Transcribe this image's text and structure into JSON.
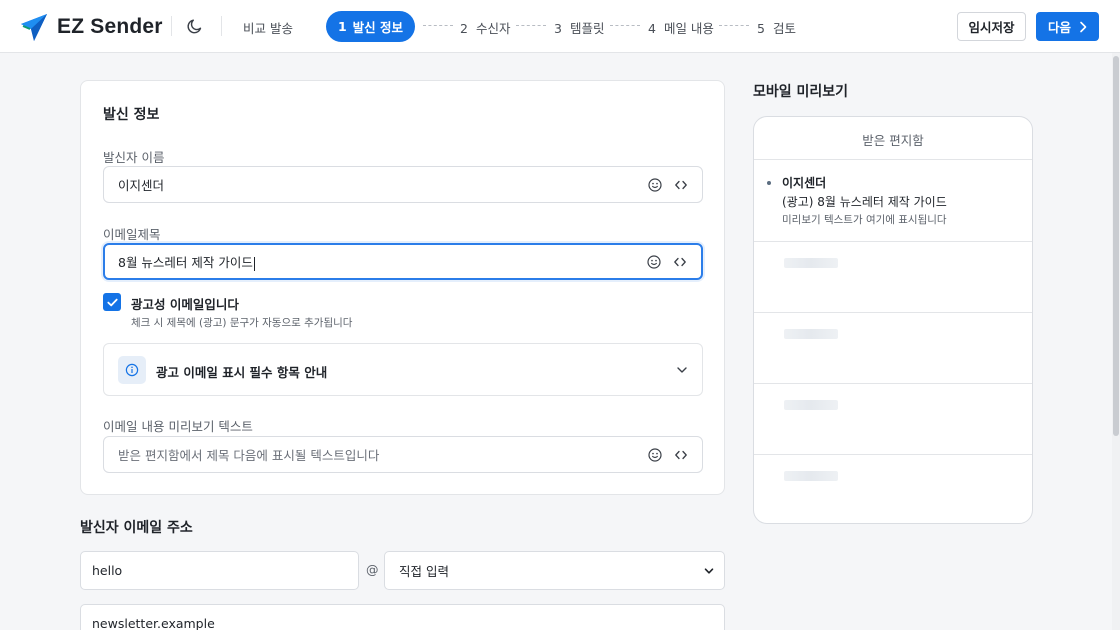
{
  "header": {
    "app_name": "EZ Sender",
    "compare_label": "비교 발송",
    "steps": [
      {
        "num": "1",
        "label": "발신 정보"
      },
      {
        "num": "2",
        "label": "수신자"
      },
      {
        "num": "3",
        "label": "템플릿"
      },
      {
        "num": "4",
        "label": "메일 내용"
      },
      {
        "num": "5",
        "label": "검토"
      }
    ],
    "active_step": 1,
    "save_label": "임시저장",
    "next_label": "다음",
    "accent_color": "#1473e6"
  },
  "sender_info": {
    "title": "발신 정보",
    "sender_name": {
      "label": "발신자 이름",
      "value": "이지센더"
    },
    "subject": {
      "label": "이메일제목",
      "value": "8월 뉴스레터 제작 가이드"
    },
    "ad_checkbox": {
      "checked": true,
      "label": "광고성 이메일입니다",
      "help": "체크 시 제목에 (광고) 문구가 자동으로 추가됩니다"
    },
    "ad_notice": {
      "label": "광고 이메일 표시 필수 항목 안내"
    },
    "preview_text": {
      "label": "이메일 내용 미리보기 텍스트",
      "placeholder": "받은 편지함에서 제목 다음에 표시될 텍스트입니다"
    }
  },
  "sender_email": {
    "title": "발신자 이메일 주소",
    "local_part": "hello",
    "at": "@",
    "domain_select": "직접 입력",
    "domain_value": "newsletter.example"
  },
  "mobile_preview": {
    "title": "모바일 미리보기",
    "inbox_label": "받은 편지함",
    "mail": {
      "sender": "이지센더",
      "subject": "(광고) 8월 뉴스레터 제작 가이드",
      "preview": "미리보기 텍스트가 여기에 표시됩니다"
    }
  },
  "icons": [
    "send-logo-icon",
    "moon-icon",
    "emoji-icon",
    "code-icon",
    "check-icon",
    "info-icon",
    "chevron-down-icon",
    "chevron-right-icon"
  ]
}
